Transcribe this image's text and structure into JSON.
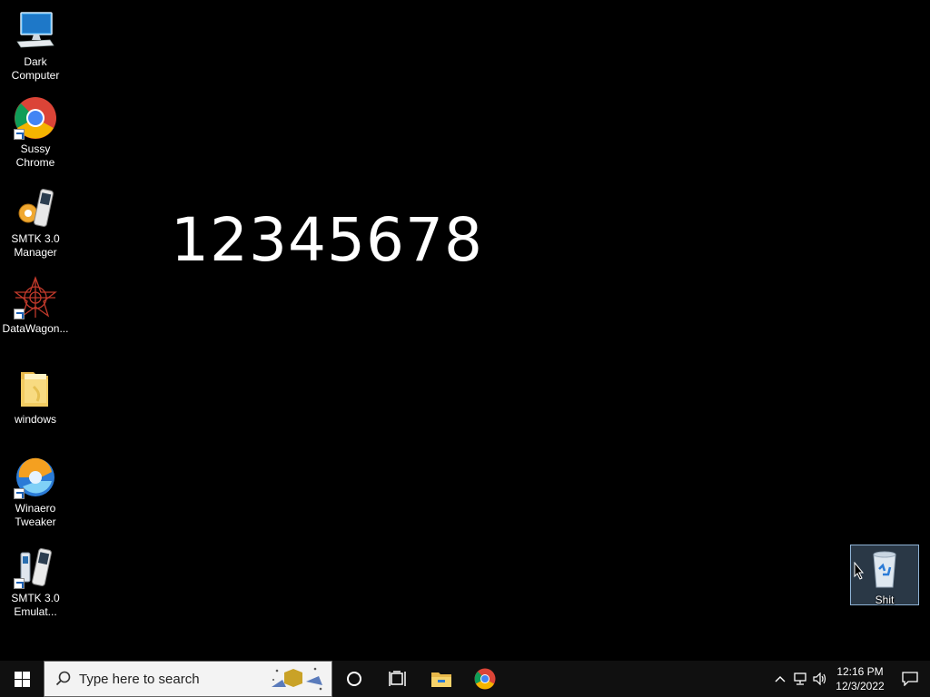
{
  "desktop_icons": [
    {
      "label": "Dark Computer"
    },
    {
      "label": "Sussy Chrome"
    },
    {
      "label": "SMTK 3.0 Manager"
    },
    {
      "label": "DataWagon..."
    },
    {
      "label": "windows"
    },
    {
      "label": "Winaero Tweaker"
    },
    {
      "label": "SMTK 3.0 Emulat..."
    }
  ],
  "big_number": "12345678",
  "recycle_bin": {
    "label": "Shit"
  },
  "taskbar": {
    "search_placeholder": "Type here to search",
    "time": "12:16 PM",
    "date": "12/3/2022"
  }
}
